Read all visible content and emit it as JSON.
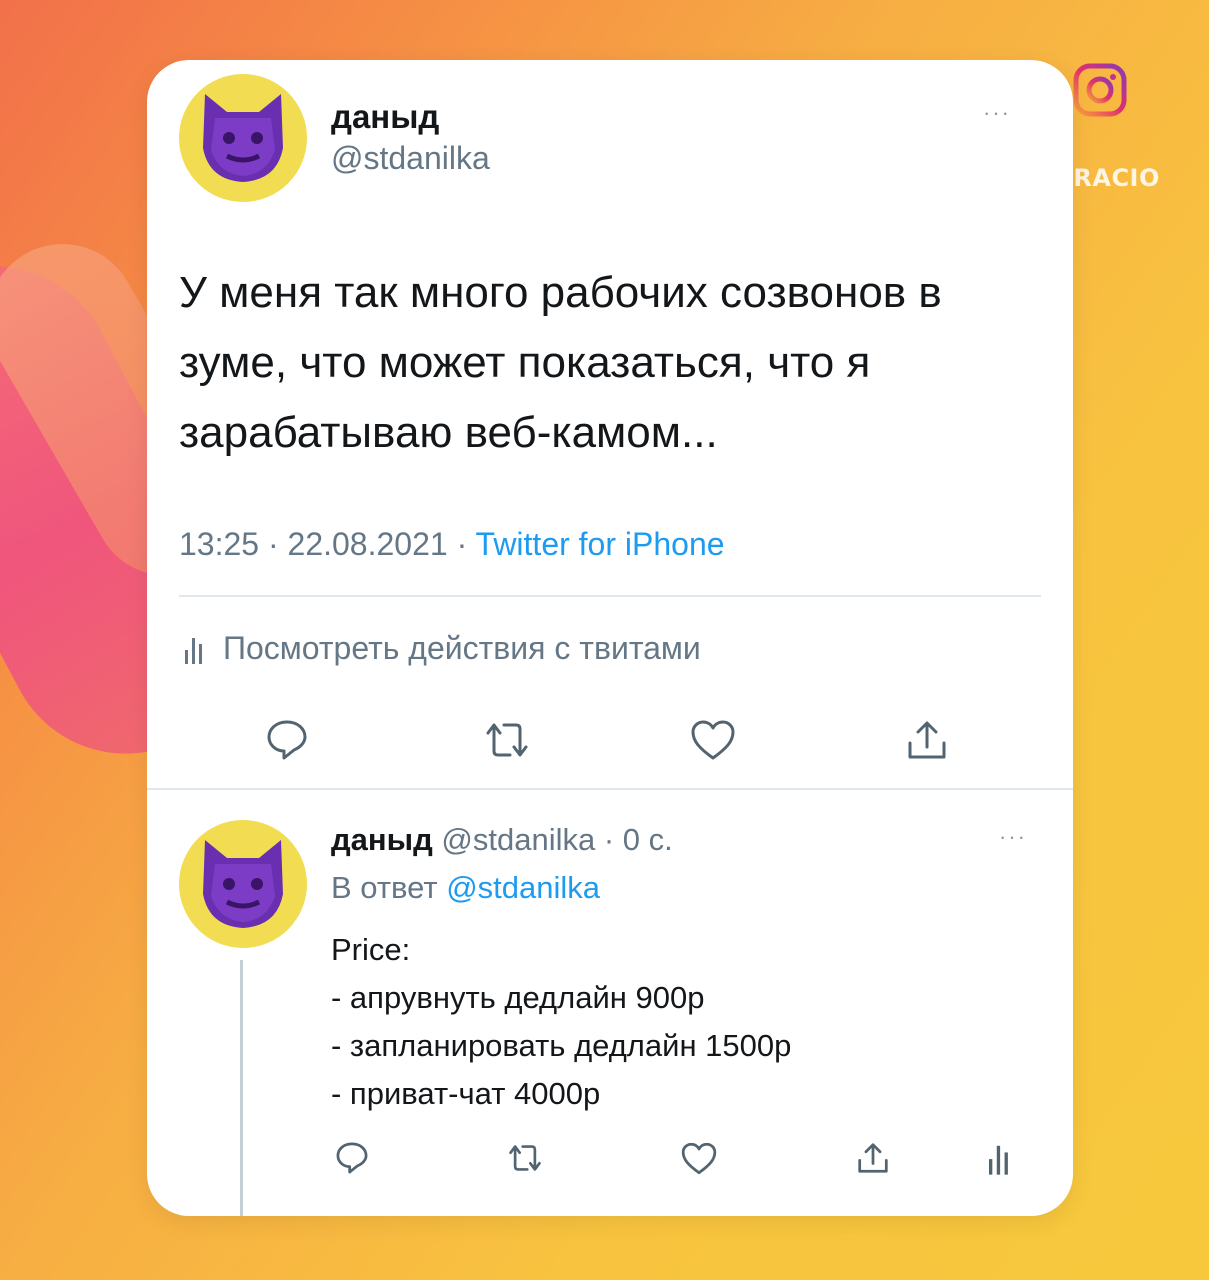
{
  "tweet": {
    "display_name": "даныд",
    "handle": "@stdanilka",
    "more": "···",
    "text": "У меня так много рабочих созвонов в зуме, что может показаться, что я зарабатываю веб-камом...",
    "time": "13:25 · 22.08.2021 ·",
    "source": "Twitter for iPhone",
    "analytics_label": "Посмотреть действия с твитами"
  },
  "reply": {
    "display_name": "даныд",
    "handle_time": "@stdanilka · 0 с.",
    "more": "···",
    "replying_prefix": "В ответ",
    "replying_handle": "@stdanilka",
    "lines": [
      "Price:",
      "- апрувнуть дедлайн 900р",
      "- запланировать дедлайн 1500р",
      "- приват-чат 4000р"
    ]
  },
  "watermark": "©ACCELERACIO",
  "icons": [
    "reply-icon",
    "retweet-icon",
    "like-icon",
    "share-icon",
    "analytics-icon",
    "instagram-icon"
  ],
  "colors": {
    "accent": "#1d9bf0",
    "avatar_bg": "#f2dd52",
    "avatar_face": "#6a2fb0",
    "secondary_text": "#657786"
  }
}
